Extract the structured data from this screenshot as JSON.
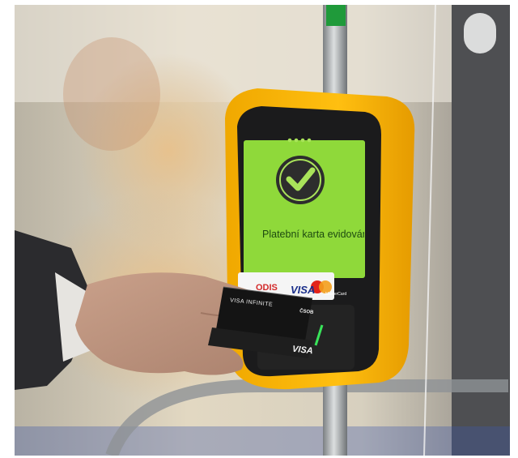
{
  "scene": {
    "screen_message": "Platební karta evidována",
    "screen_indicator_dots": 4,
    "accepted_payments": [
      "ODIS",
      "VISA",
      "MasterCard"
    ],
    "card_texts": [
      "VISA INFINITE",
      "ČSOB",
      "VISA"
    ],
    "colors": {
      "validator_body": "#f5b400",
      "screen_background": "#8fd93a",
      "check_badge": "#2d2d2d",
      "check_mark": "#a9e35a",
      "pole": "#a7abae"
    }
  }
}
